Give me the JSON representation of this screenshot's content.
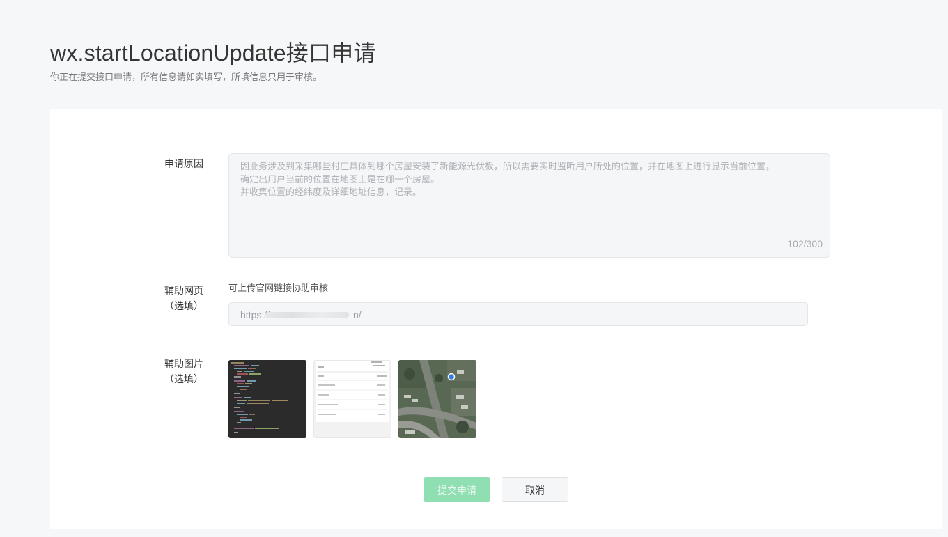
{
  "header": {
    "title": "wx.startLocationUpdate接口申请",
    "subtitle": "你正在提交接口申请，所有信息请如实填写，所填信息只用于审核。"
  },
  "form": {
    "reason": {
      "label": "申请原因",
      "text": "因业务涉及到采集哪些村庄具体到哪个房屋安装了新能源光伏板，所以需要实时监听用户所处的位置，并在地图上进行显示当前位置，\n确定出用户当前的位置在地图上是在哪一个房屋。\n并收集位置的经纬度及详细地址信息，记录。",
      "counter": "102/300"
    },
    "webpage": {
      "label_line1": "辅助网页",
      "label_line2": "（选填）",
      "hint": "可上传官网链接协助审核",
      "value_prefix": "https://",
      "value_suffix": "n/"
    },
    "images": {
      "label_line1": "辅助图片",
      "label_line2": "（选填）"
    }
  },
  "actions": {
    "submit_label": "提交申请",
    "cancel_label": "取消"
  },
  "colors": {
    "accent_disabled": "#8fdfb2",
    "background": "#f6f7f9"
  }
}
